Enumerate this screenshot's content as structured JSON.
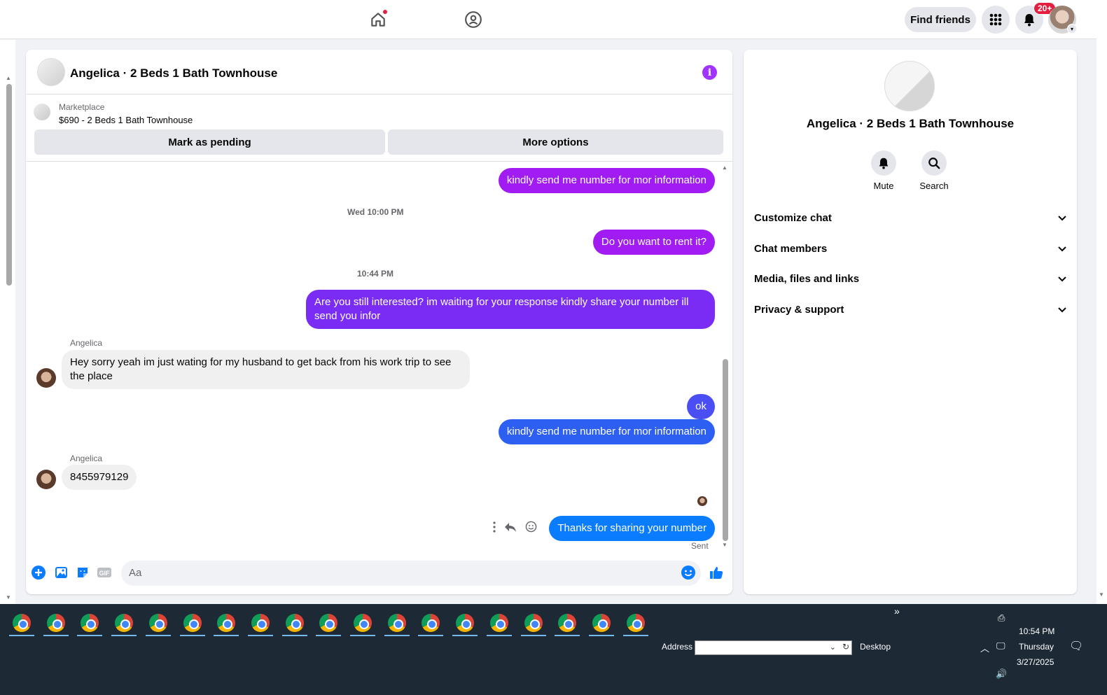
{
  "topbar": {
    "find_friends": "Find friends",
    "notif_count": "20+"
  },
  "chat": {
    "title": "Angelica · 2 Beds 1 Bath Townhouse",
    "marketplace_label": "Marketplace",
    "listing": "$690 - 2 Beds 1 Bath Townhouse",
    "mark_pending": "Mark as pending",
    "more_options": "More options",
    "messages": {
      "m1": "kindly send me number for mor information",
      "ts1": "Wed 10:00 PM",
      "m2": "Do you want to rent it?",
      "ts2": "10:44 PM",
      "m3": "Are you still interested? im waiting for your response kindly share your number ill send you infor",
      "sender1": "Angelica",
      "m4": "Hey sorry yeah im just wating for my husband to get back from his work trip to see the place",
      "m5": "ok",
      "m6": "kindly send me number for mor information",
      "sender2": "Angelica",
      "m7": "8455979129",
      "m8": "Thanks for sharing your number",
      "sent": "Sent"
    },
    "composer_placeholder": "Aa"
  },
  "panel": {
    "name": "Angelica · 2 Beds 1 Bath Townhouse",
    "mute": "Mute",
    "search": "Search",
    "rows": [
      "Customize chat",
      "Chat members",
      "Media, files and links",
      "Privacy & support"
    ]
  },
  "taskbar": {
    "app_count": 19,
    "address_label": "Address",
    "desktop_label": "Desktop",
    "time": "10:54 PM",
    "day": "Thursday",
    "date": "3/27/2025"
  },
  "colors": {
    "accent_purple": "#a01cf3",
    "accent_blue": "#0a7cff",
    "info_purple": "#a033ff"
  }
}
